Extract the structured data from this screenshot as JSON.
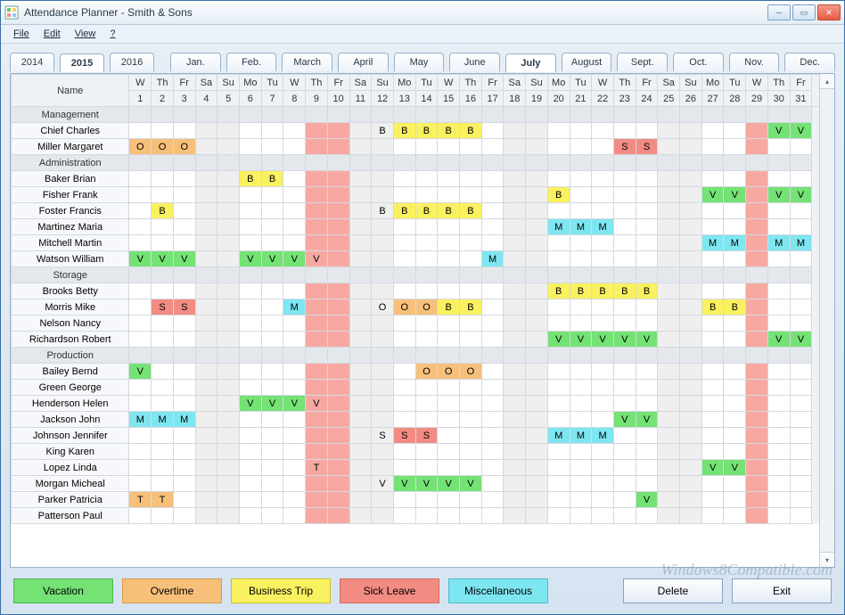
{
  "title": "Attendance Planner - Smith & Sons",
  "menu": [
    "File",
    "Edit",
    "View",
    "?"
  ],
  "years": [
    "2014",
    "2015",
    "2016"
  ],
  "year_selected": 1,
  "months": [
    "Jan.",
    "Feb.",
    "March",
    "April",
    "May",
    "June",
    "July",
    "August",
    "Sept.",
    "Oct.",
    "Nov.",
    "Dec."
  ],
  "month_selected": 6,
  "name_header": "Name",
  "days": [
    {
      "dow": "W",
      "num": "1",
      "we": false
    },
    {
      "dow": "Th",
      "num": "2",
      "we": false
    },
    {
      "dow": "Fr",
      "num": "3",
      "we": false
    },
    {
      "dow": "Sa",
      "num": "4",
      "we": true
    },
    {
      "dow": "Su",
      "num": "5",
      "we": true
    },
    {
      "dow": "Mo",
      "num": "6",
      "we": false
    },
    {
      "dow": "Tu",
      "num": "7",
      "we": false
    },
    {
      "dow": "W",
      "num": "8",
      "we": false
    },
    {
      "dow": "Th",
      "num": "9",
      "we": false,
      "hol": true
    },
    {
      "dow": "Fr",
      "num": "10",
      "we": false,
      "hol": true
    },
    {
      "dow": "Sa",
      "num": "11",
      "we": true
    },
    {
      "dow": "Su",
      "num": "12",
      "we": true
    },
    {
      "dow": "Mo",
      "num": "13",
      "we": false
    },
    {
      "dow": "Tu",
      "num": "14",
      "we": false
    },
    {
      "dow": "W",
      "num": "15",
      "we": false
    },
    {
      "dow": "Th",
      "num": "16",
      "we": false
    },
    {
      "dow": "Fr",
      "num": "17",
      "we": false
    },
    {
      "dow": "Sa",
      "num": "18",
      "we": true
    },
    {
      "dow": "Su",
      "num": "19",
      "we": true
    },
    {
      "dow": "Mo",
      "num": "20",
      "we": false
    },
    {
      "dow": "Tu",
      "num": "21",
      "we": false
    },
    {
      "dow": "W",
      "num": "22",
      "we": false
    },
    {
      "dow": "Th",
      "num": "23",
      "we": false
    },
    {
      "dow": "Fr",
      "num": "24",
      "we": false
    },
    {
      "dow": "Sa",
      "num": "25",
      "we": true
    },
    {
      "dow": "Su",
      "num": "26",
      "we": true
    },
    {
      "dow": "Mo",
      "num": "27",
      "we": false
    },
    {
      "dow": "Tu",
      "num": "28",
      "we": false
    },
    {
      "dow": "W",
      "num": "29",
      "we": false,
      "hol": true
    },
    {
      "dow": "Th",
      "num": "30",
      "we": false
    },
    {
      "dow": "Fr",
      "num": "31",
      "we": false
    }
  ],
  "rows": [
    {
      "name": "Management",
      "group": true
    },
    {
      "name": "Chief Charles",
      "cells": {
        "12": "B",
        "13": "B",
        "14": "B",
        "15": "B",
        "16": "B",
        "30": "V",
        "31": "V"
      }
    },
    {
      "name": "Miller Margaret",
      "cells": {
        "1": "O",
        "2": "O",
        "3": "O",
        "23": "S",
        "24": "S"
      }
    },
    {
      "name": "Administration",
      "group": true
    },
    {
      "name": "Baker Brian",
      "cells": {
        "6": "B",
        "7": "B"
      }
    },
    {
      "name": "Fisher Frank",
      "cells": {
        "20": "B",
        "27": "V",
        "28": "V",
        "30": "V",
        "31": "V"
      }
    },
    {
      "name": "Foster Francis",
      "cells": {
        "2": "B",
        "12": "B",
        "13": "B",
        "14": "B",
        "15": "B",
        "16": "B"
      }
    },
    {
      "name": "Martinez Maria",
      "cells": {
        "20": "M",
        "21": "M",
        "22": "M"
      }
    },
    {
      "name": "Mitchell Martin",
      "cells": {
        "27": "M",
        "28": "M",
        "30": "M",
        "31": "M"
      }
    },
    {
      "name": "Watson William",
      "cells": {
        "1": "V",
        "2": "V",
        "3": "V",
        "6": "V",
        "7": "V",
        "8": "V",
        "9": "V",
        "17": "M"
      }
    },
    {
      "name": "Storage",
      "group": true
    },
    {
      "name": "Brooks Betty",
      "cells": {
        "20": "B",
        "21": "B",
        "22": "B",
        "23": "B",
        "24": "B"
      }
    },
    {
      "name": "Morris Mike",
      "cells": {
        "2": "S",
        "3": "S",
        "8": "M",
        "12": "O",
        "13": "O",
        "14": "O",
        "15": "B",
        "16": "B",
        "27": "B",
        "28": "B"
      }
    },
    {
      "name": "Nelson Nancy",
      "cells": {}
    },
    {
      "name": "Richardson Robert",
      "cells": {
        "20": "V",
        "21": "V",
        "22": "V",
        "23": "V",
        "24": "V",
        "30": "V",
        "31": "V"
      }
    },
    {
      "name": "Production",
      "group": true
    },
    {
      "name": "Bailey Bernd",
      "cells": {
        "1": "V",
        "14": "O",
        "15": "O",
        "16": "O"
      }
    },
    {
      "name": "Green George",
      "cells": {}
    },
    {
      "name": "Henderson Helen",
      "cells": {
        "6": "V",
        "7": "V",
        "8": "V",
        "9": "V"
      }
    },
    {
      "name": "Jackson John",
      "cells": {
        "1": "M",
        "2": "M",
        "3": "M",
        "23": "V",
        "24": "V"
      }
    },
    {
      "name": "Johnson Jennifer",
      "cells": {
        "12": "S",
        "13": "S",
        "14": "S",
        "20": "M",
        "21": "M",
        "22": "M"
      }
    },
    {
      "name": "King Karen",
      "cells": {}
    },
    {
      "name": "Lopez Linda",
      "cells": {
        "9": "T",
        "27": "V",
        "28": "V"
      }
    },
    {
      "name": "Morgan Micheal",
      "cells": {
        "12": "V",
        "13": "V",
        "14": "V",
        "15": "V",
        "16": "V"
      }
    },
    {
      "name": "Parker Patricia",
      "cells": {
        "1": "T",
        "2": "T",
        "24": "V"
      }
    },
    {
      "name": "Patterson Paul",
      "cells": {}
    }
  ],
  "buttons": {
    "vacation": "Vacation",
    "overtime": "Overtime",
    "business": "Business Trip",
    "sick": "Sick Leave",
    "misc": "Miscellaneous",
    "delete": "Delete",
    "exit": "Exit"
  },
  "watermark": "Windows8Compatible.com"
}
